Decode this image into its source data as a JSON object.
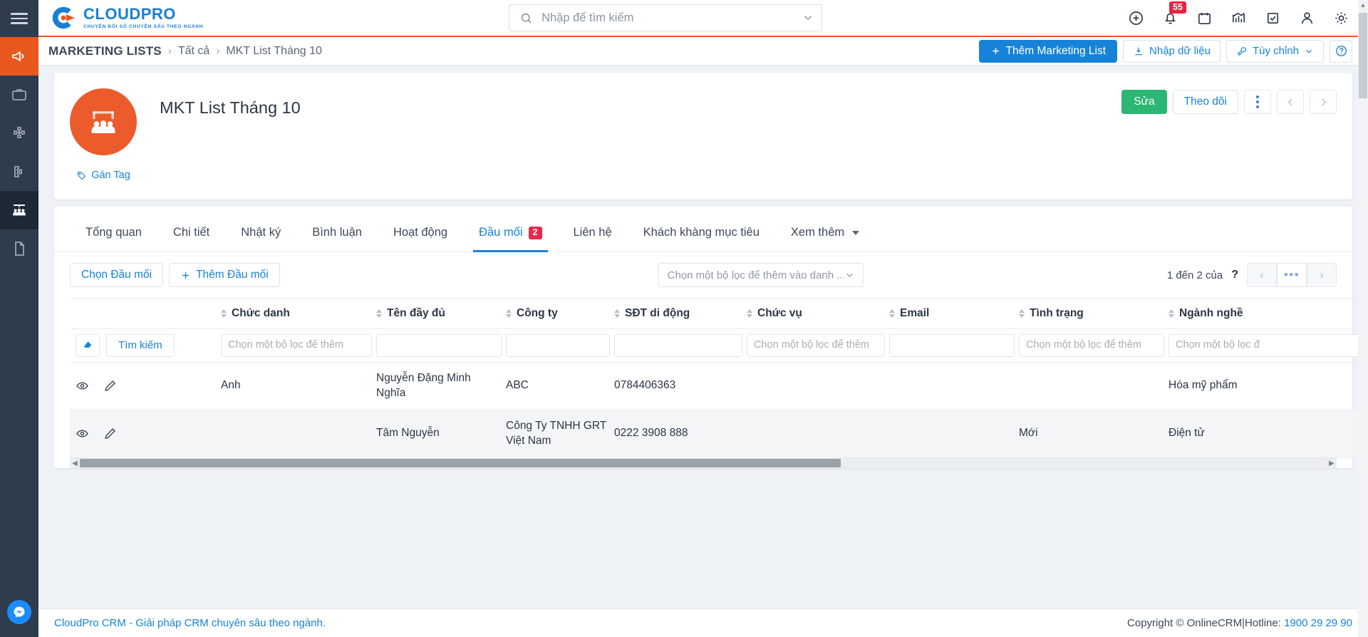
{
  "brand": {
    "name": "CLOUDPRO",
    "tagline": "CHUYỂN ĐỔI SỐ CHUYÊN SÂU THEO NGÀNH",
    "accent": "#e8581f",
    "blue": "#1683d8"
  },
  "topbar": {
    "menu_icon": "hamburger-icon",
    "search": {
      "placeholder": "Nhập để tìm kiếm",
      "icon": "search-icon",
      "dropdown_icon": "chevron-down-icon"
    },
    "icons": [
      {
        "name": "add-circle-icon",
        "label": ""
      },
      {
        "name": "notification-bell-icon",
        "label": "",
        "badge": "55"
      },
      {
        "name": "calendar-icon",
        "label": ""
      },
      {
        "name": "analytics-icon",
        "label": ""
      },
      {
        "name": "task-check-icon",
        "label": ""
      },
      {
        "name": "user-icon",
        "label": ""
      },
      {
        "name": "settings-gear-icon",
        "label": ""
      }
    ]
  },
  "breadcrumb": {
    "module": "MARKETING LISTS",
    "sep": "›",
    "level1": "Tất cả",
    "level2": "MKT List Tháng 10",
    "actions": {
      "add": "Thêm Marketing List",
      "import": "Nhập dữ liệu",
      "customize": "Tùy chỉnh",
      "help": "?"
    }
  },
  "record": {
    "title": "MKT List Tháng 10",
    "avatar_icon": "audience-presentation-icon",
    "tag_label": "Gán Tag",
    "actions": {
      "edit": "Sửa",
      "follow": "Theo dõi",
      "more": "",
      "prev": "‹",
      "next": "›"
    }
  },
  "tabs": [
    {
      "label": "Tổng quan",
      "active": false
    },
    {
      "label": "Chi tiết",
      "active": false
    },
    {
      "label": "Nhật ký",
      "active": false
    },
    {
      "label": "Bình luận",
      "active": false
    },
    {
      "label": "Hoạt động",
      "active": false
    },
    {
      "label": "Đầu mối",
      "active": true,
      "count": "2"
    },
    {
      "label": "Liên hệ",
      "active": false
    },
    {
      "label": "Khách khàng mục tiêu",
      "active": false
    },
    {
      "label": "Xem thêm",
      "active": false,
      "dropdown": true
    }
  ],
  "toolbar": {
    "select_lead": "Chọn Đầu mối",
    "add_lead": "Thêm Đầu mối",
    "filter_placeholder": "Chọn một bộ lọc để thêm vào danh ...",
    "pager_text": "1 đến 2 của",
    "pager_unknown": "?",
    "pager_prev": "‹",
    "pager_mid": "•••",
    "pager_next": "›"
  },
  "table": {
    "search_button": "Tìm kiếm",
    "erase_icon": "eraser-icon",
    "columns": [
      {
        "key": "actions",
        "label": "",
        "sortable": false,
        "filter": null
      },
      {
        "key": "chuc_danh",
        "label": "Chức danh",
        "sortable": true,
        "filter": "Chọn một bộ lọc để thêm"
      },
      {
        "key": "ten_day_du",
        "label": "Tên đầy đủ",
        "sortable": true,
        "filter": ""
      },
      {
        "key": "cong_ty",
        "label": "Công ty",
        "sortable": true,
        "filter": ""
      },
      {
        "key": "sdt_di_dong",
        "label": "SĐT di động",
        "sortable": true,
        "filter": ""
      },
      {
        "key": "chuc_vu",
        "label": "Chức vụ",
        "sortable": true,
        "filter": "Chọn một bộ lọc để thêm"
      },
      {
        "key": "email",
        "label": "Email",
        "sortable": true,
        "filter": ""
      },
      {
        "key": "tinh_trang",
        "label": "Tình trạng",
        "sortable": true,
        "filter": "Chọn một bộ lọc để thêm"
      },
      {
        "key": "nganh_nghe",
        "label": "Ngành nghề",
        "sortable": true,
        "filter": "Chọn một bộ lọc đ"
      }
    ],
    "rows": [
      {
        "view_icon": "eye-icon",
        "edit_icon": "pencil-icon",
        "chuc_danh": "Anh",
        "ten_day_du": "Nguyễn Đặng Minh Nghĩa",
        "cong_ty": "ABC",
        "sdt_di_dong": "0784406363",
        "chuc_vu": "",
        "email": "",
        "tinh_trang": "",
        "nganh_nghe": "Hóa mỹ phẩm"
      },
      {
        "view_icon": "eye-icon",
        "edit_icon": "pencil-icon",
        "chuc_danh": "",
        "ten_day_du": "Tâm Nguyễn",
        "cong_ty": "Công Ty TNHH GRT Việt Nam",
        "sdt_di_dong": "0222 3908 888",
        "chuc_vu": "",
        "email": "",
        "tinh_trang": "Mới",
        "nganh_nghe": "Điện tử"
      }
    ]
  },
  "footer": {
    "left": "CloudPro CRM - Giải pháp CRM chuyên sâu theo ngành.",
    "copyright": "Copyright © OnlineCRM",
    "divider": "|",
    "hotline_label": "Hotline:",
    "hotline": "1900 29 29 90"
  }
}
